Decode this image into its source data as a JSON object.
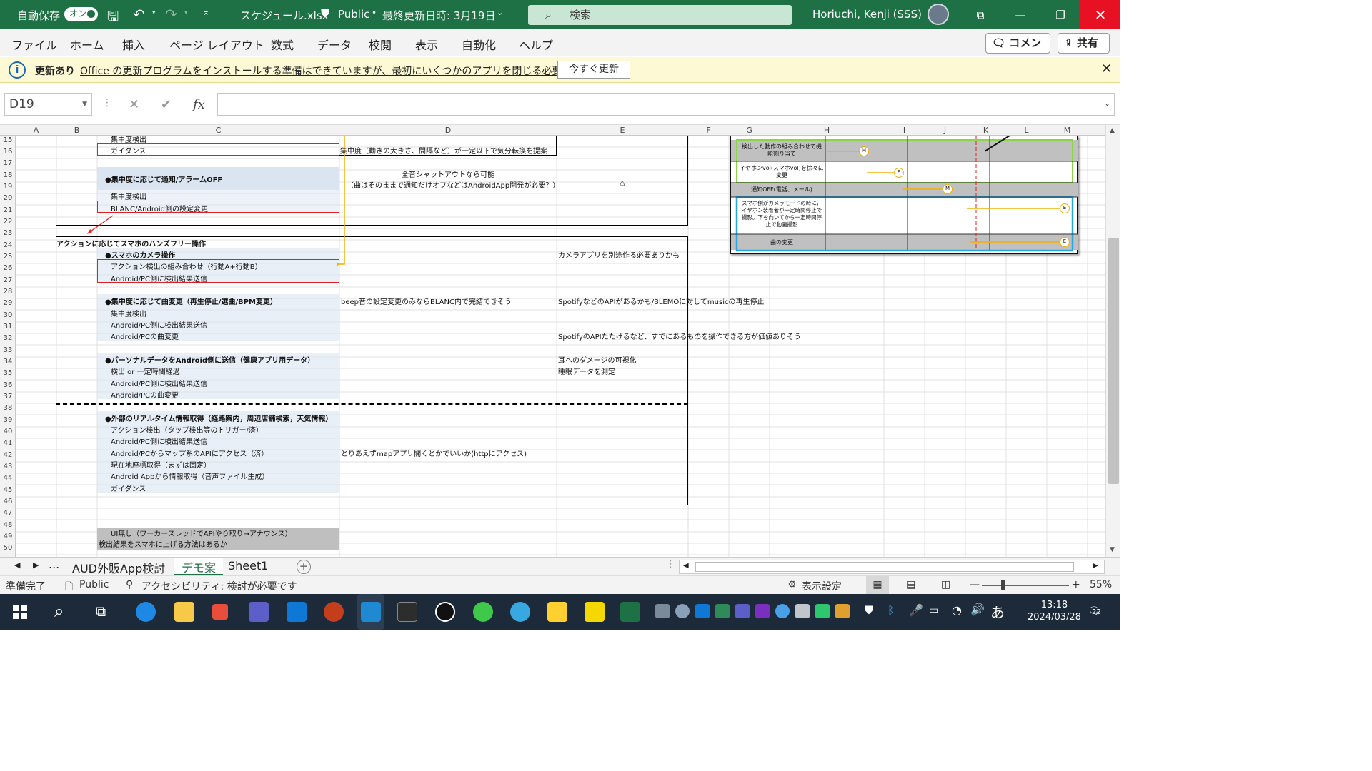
{
  "title_bar": {
    "autosave_label": "自動保存",
    "autosave_state": "オン",
    "filename": "スケジュール.xlsx",
    "sensitivity": "Public",
    "last_modified": "最終更新日時: 3月19日",
    "search_placeholder": "検索",
    "user": "Horiuchi, Kenji (SSS)",
    "accent": "#1e7145"
  },
  "menu": {
    "items": [
      "ファイル",
      "ホーム",
      "挿入",
      "ページ レイアウト",
      "数式",
      "データ",
      "校閲",
      "表示",
      "自動化",
      "ヘルプ"
    ],
    "comment_label": "コメント",
    "share_label": "共有"
  },
  "infobar": {
    "title": "更新あり",
    "message": "Office の更新プログラムをインストールする準備はできていますが、最初にいくつかのアプリを閉じる必要があります。",
    "button": "今すぐ更新"
  },
  "formula_bar": {
    "name_box": "D19",
    "fx": "fx",
    "formula": ""
  },
  "columns": [
    "A",
    "B",
    "C",
    "D",
    "E",
    "F",
    "G",
    "H",
    "I",
    "J",
    "K",
    "L",
    "M"
  ],
  "rows": [
    "15",
    "16",
    "17",
    "18",
    "19",
    "20",
    "21",
    "22",
    "23",
    "24",
    "25",
    "26",
    "27",
    "28",
    "29",
    "30",
    "31",
    "32",
    "33",
    "34",
    "35",
    "36",
    "37",
    "38",
    "39",
    "40",
    "41",
    "42",
    "43",
    "44",
    "45",
    "46",
    "47",
    "48",
    "49",
    "50"
  ],
  "cells": {
    "r15c": "集中度検出",
    "r16c": "ガイダンス",
    "r16d": "集中度（動きの大きさ、間隔など）が一定以下で気分転換を提案",
    "r18c": "●集中度に応じて通知/アラームOFF",
    "r18d1": "全音シャットアウトなら可能",
    "r18d2": "（曲はそのままで通知だけオフなどはAndroidApp開発が必要？）",
    "r18e": "△",
    "r19c": "集中度検出",
    "r20c": "BLANC/Android側の設定変更",
    "r23a": "アクションに応じてスマホのハンズフリー操作",
    "r24c": "●スマホのカメラ操作",
    "r24e": "カメラアプリを別途作る必要ありかも",
    "r25c": "アクション検出の組み合わせ（行動A+行動B）",
    "r26c": "Android/PC側に検出結果送信",
    "r28c": "●集中度に応じて曲変更（再生停止/選曲/BPM変更）",
    "r28d": "beep音の設定変更のみならBLANC内で完結できそう",
    "r28e": "SpotifyなどのAPIがあるかも/BLEMOに対してmusicの再生停止",
    "r29c": "集中度検出",
    "r30c": "Android/PC側に検出結果送信",
    "r31c": "Android/PCの曲変更",
    "r31e": "SpotifyのAPIたたけるなど、すでにあるものを操作できる方が価値ありそう",
    "r33c": "●パーソナルデータをAndroid側に送信（健康アプリ用データ）",
    "r33e": "耳へのダメージの可視化",
    "r34c": "検出 or 一定時間経過",
    "r34e": "睡眠データを測定",
    "r35c": "Android/PC側に検出結果送信",
    "r36c": "Android/PCの曲変更",
    "r38c": "●外部のリアルタイム情報取得（経路案内，周辺店舗検索，天気情報）",
    "r39c": "アクション検出（タップ検出等のトリガー/済）",
    "r40c": "Android/PC側に検出結果送信",
    "r41c": "Android/PCからマップ系のAPIにアクセス（済）",
    "r41d": "とりあえずmapアプリ開くとかでいいか(httpにアクセス)",
    "r42c": "現在地座標取得（まずは固定）",
    "r43c": "Android Appから情報取得（音声ファイル生成）",
    "r44c": "ガイダンス",
    "r48c": "UI無し（ワーカースレッドでAPIやり取り→アナウンス）",
    "r49c": "検出結果をスマホに上げる方法はあるか"
  },
  "gantt": {
    "rows": [
      "検出した動作の組み合わせで機能割り当て",
      "イヤホンvol(スマホvol)を徐々に変更",
      "通知OFF(電話、メール)",
      "スマホ側がカメラモードの時に，イヤホン装着者が一定時間停止で撮影。下を向いてから一定時間停止で動画撮影",
      "曲の変更"
    ],
    "markers": [
      "M",
      "E",
      "M",
      "E",
      "E"
    ]
  },
  "sheet_tabs": {
    "ellipsis": "...",
    "tabs": [
      "AUD外販App検討",
      "デモ案",
      "Sheet1"
    ],
    "active": "デモ案"
  },
  "status": {
    "ready": "準備完了",
    "sensitivity": "Public",
    "accessibility": "アクセシビリティ: 検討が必要です",
    "display_settings": "表示設定",
    "zoom": "55%"
  },
  "taskbar": {
    "time": "13:18",
    "date": "2024/03/28",
    "ime": "あ",
    "notifications": "22"
  }
}
